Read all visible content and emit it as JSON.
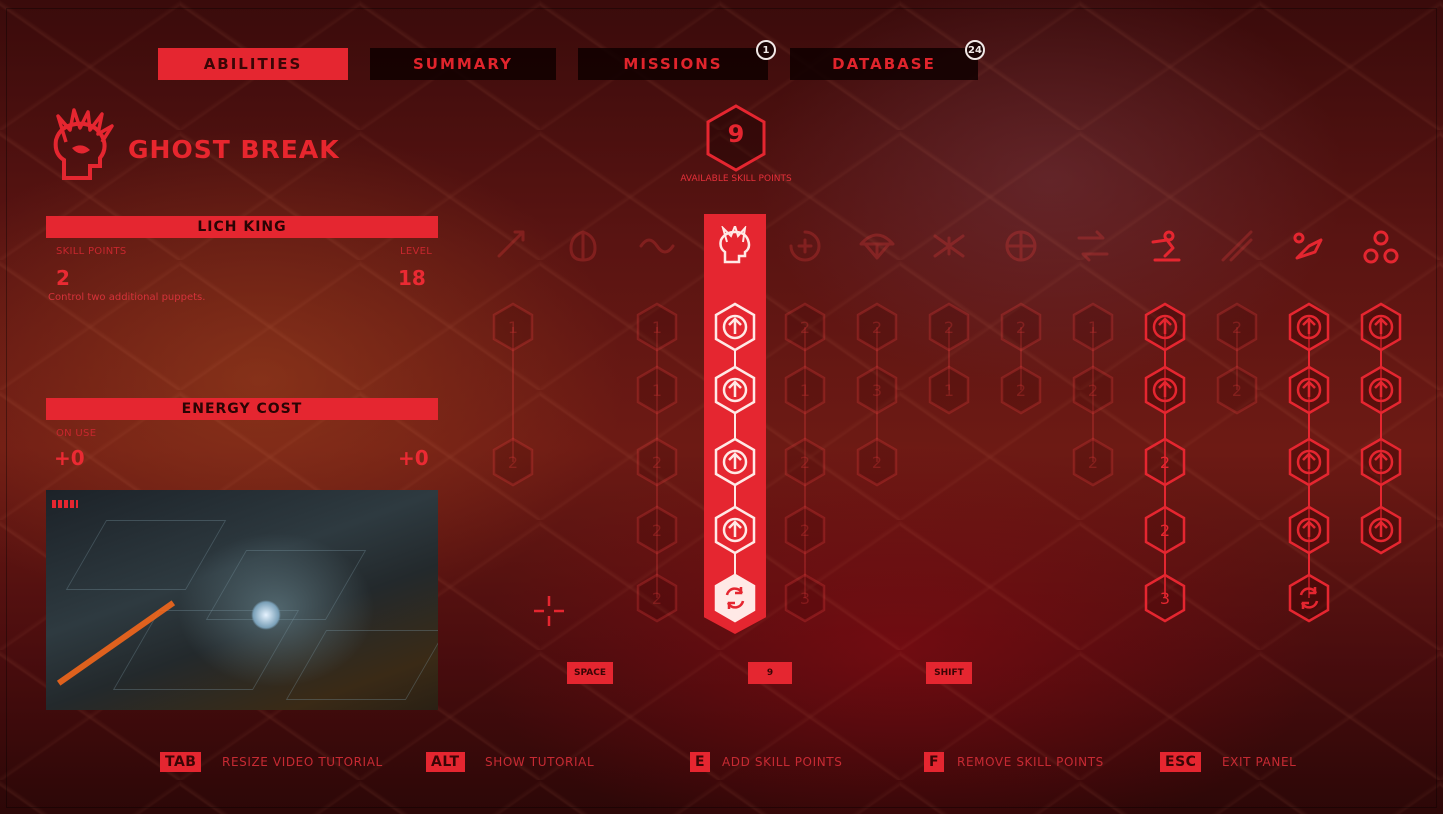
{
  "tabs": [
    {
      "label": "ABILITIES",
      "active": true
    },
    {
      "label": "SUMMARY",
      "active": false
    },
    {
      "label": "MISSIONS",
      "active": false,
      "badge": "1"
    },
    {
      "label": "DATABASE",
      "active": false,
      "badge": "24"
    }
  ],
  "ability": {
    "name": "GHOST BREAK",
    "upgrade_title": "LICH KING",
    "skill_points_label": "SKILL POINTS",
    "skill_points_value": "2",
    "level_label": "LEVEL",
    "level_value": "18",
    "description": "Control two additional puppets.",
    "energy_title": "ENERGY COST",
    "on_use_label": "ON USE",
    "on_use_value": "+0",
    "upkeep_value": "+0"
  },
  "skill_counter": {
    "value": "9",
    "label": "AVAILABLE SKILL POINTS"
  },
  "keys": {
    "space": "SPACE",
    "count": "9",
    "shift": "SHIFT"
  },
  "columns": [
    {
      "icon": "stab-icon",
      "cells": [
        "1",
        "",
        "2"
      ],
      "dim": true
    },
    {
      "icon": "beetle-icon",
      "cells": [],
      "dim": true
    },
    {
      "icon": "wave-icon",
      "cells": [
        "1",
        "1",
        "2",
        "2",
        "2"
      ],
      "dim": true
    },
    {
      "icon": "ghost-break-icon",
      "cells": [
        "up",
        "up",
        "up",
        "up",
        "cycle"
      ],
      "selected": true
    },
    {
      "icon": "heal-cycle-icon",
      "cells": [
        "2",
        "1",
        "2",
        "2",
        "3"
      ],
      "dim": true
    },
    {
      "icon": "parachute-icon",
      "cells": [
        "2",
        "3",
        "2"
      ],
      "dim": true
    },
    {
      "icon": "spider-icon",
      "cells": [
        "2",
        "1"
      ],
      "dim": true
    },
    {
      "icon": "target-icon",
      "cells": [
        "2",
        "2"
      ],
      "dim": true
    },
    {
      "icon": "swap-icon",
      "cells": [
        "1",
        "2",
        "2"
      ],
      "dim": true
    },
    {
      "icon": "sprint-icon",
      "cells": [
        "up",
        "up",
        "2",
        "2",
        "3"
      ],
      "active": true
    },
    {
      "icon": "slash-icon",
      "cells": [
        "2",
        "2"
      ],
      "dim": true
    },
    {
      "icon": "turret-icon",
      "cells": [
        "up",
        "up",
        "up",
        "up",
        "cycle"
      ],
      "active": true
    },
    {
      "icon": "cluster-icon",
      "cells": [
        "up",
        "up",
        "up",
        "up"
      ],
      "active": true
    }
  ],
  "hints": [
    {
      "key": "TAB",
      "label": "RESIZE VIDEO TUTORIAL"
    },
    {
      "key": "ALT",
      "label": "SHOW TUTORIAL"
    },
    {
      "key": "E",
      "label": "ADD SKILL POINTS"
    },
    {
      "key": "F",
      "label": "REMOVE SKILL POINTS"
    },
    {
      "key": "ESC",
      "label": "EXIT PANEL"
    }
  ],
  "colors": {
    "accent": "#e52630",
    "dark": "#2a0404",
    "text": "#e8202a"
  }
}
